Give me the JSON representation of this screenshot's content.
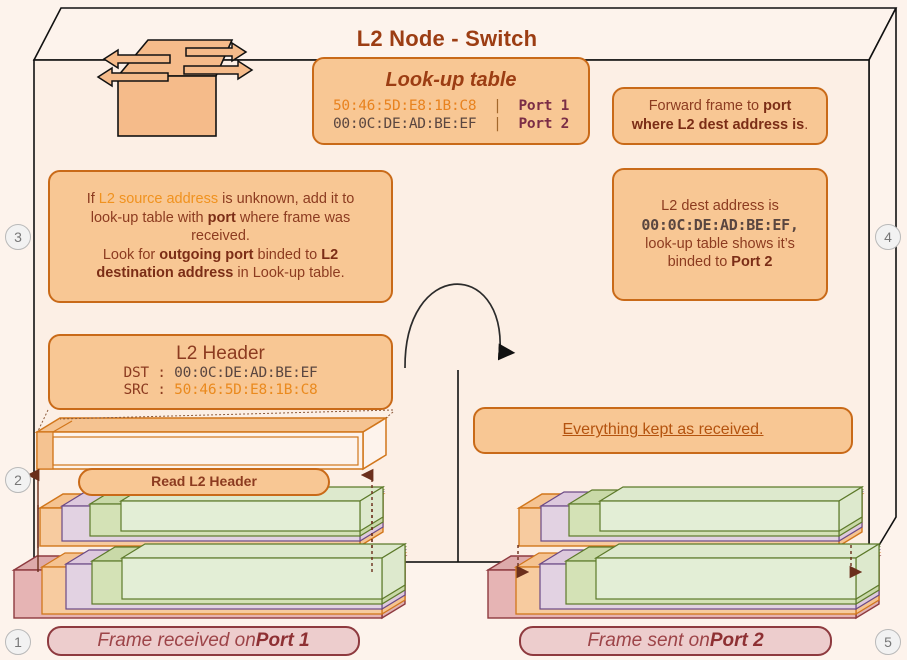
{
  "diagram": {
    "title": "L2 Node - Switch",
    "node_icon": "switch-icon"
  },
  "lookup_table": {
    "heading": "Look-up table",
    "rows": [
      {
        "mac": "50:46:5D:E8:1B:C8",
        "sep": "|",
        "port": "Port 1"
      },
      {
        "mac": "00:0C:DE:AD:BE:EF",
        "sep": "|",
        "port": "Port 2"
      }
    ]
  },
  "boxes": {
    "forward": {
      "line1_pre": "Forward frame to ",
      "line1_bold": "port",
      "line2_bold": "where L2 dest address is",
      "line2_post": "."
    },
    "rule": {
      "l1_pre": "If ",
      "l1_em": "L2 source address",
      "l1_post": " is unknown, add it to",
      "l2_pre": "look-up table with ",
      "l2_bold": "port",
      "l2_post": " where frame was",
      "l3": "received.",
      "l4_pre": "Look for ",
      "l4_bold": "outgoing port",
      "l4_mid": " binded to ",
      "l4_bold2": "L2",
      "l5_bold": "destination address",
      "l5_post": " in Look-up table."
    },
    "dest": {
      "l1": "L2 dest address is",
      "mac": "00:0C:DE:AD:BE:EF,",
      "l3": "look-up table shows it’s",
      "l4_pre": "binded to ",
      "l4_bold": "Port 2"
    },
    "l2_header": {
      "title": "L2 Header",
      "dst_label": "DST : ",
      "dst_value": "00:0C:DE:AD:BE:EF",
      "src_label": "SRC : ",
      "src_value": "50:46:5D:E8:1B:C8"
    },
    "read_pill": "Read L2 Header",
    "kept": "Everything kept as received."
  },
  "port_labels": {
    "received_pre": "Frame received on ",
    "received_bold": "Port 1",
    "sent_pre": "Frame sent on ",
    "sent_bold": "Port 2"
  },
  "steps": {
    "s1": "1",
    "s2": "2",
    "s3": "3",
    "s4": "4",
    "s5": "5"
  },
  "colors": {
    "background": "#fdf3ec",
    "node_fill": "#fcefe5",
    "callout_fill": "#f8c794",
    "callout_border": "#c96a18",
    "title": "#9c3d13",
    "port_label_fill": "#edcdcd",
    "port_label_border": "#8e3a3f",
    "layer_l1": "#e6b4b4",
    "layer_l2": "#f5c391",
    "layer_l3": "#ddc9dd",
    "layer_l4": "#c9d9a8",
    "layer_payload": "#dde9cd"
  }
}
